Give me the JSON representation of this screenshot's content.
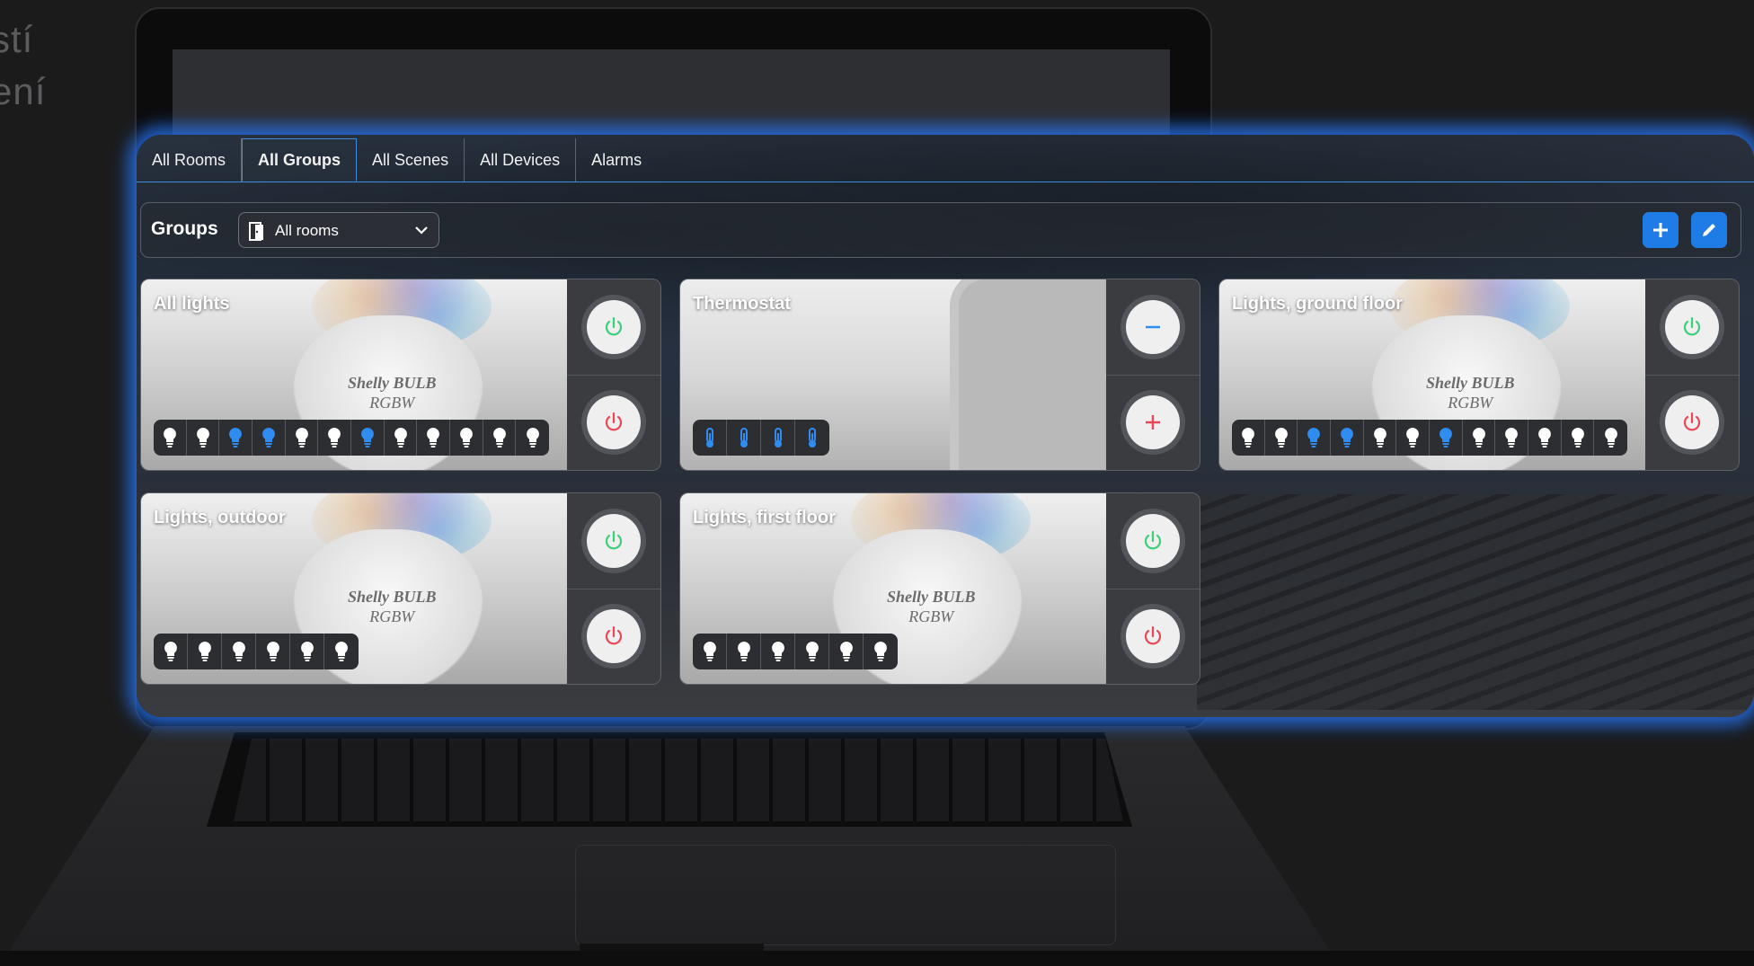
{
  "background": {
    "line1": "stí",
    "line2": "ení"
  },
  "tabs": [
    {
      "label": "All Rooms",
      "active": false
    },
    {
      "label": "All Groups",
      "active": true
    },
    {
      "label": "All Scenes",
      "active": false
    },
    {
      "label": "All Devices",
      "active": false
    },
    {
      "label": "Alarms",
      "active": false
    }
  ],
  "toolbar": {
    "title": "Groups",
    "room_select": {
      "selected": "All rooms",
      "icon": "door-icon"
    },
    "add_icon": "plus-icon",
    "edit_icon": "pencil-icon"
  },
  "colors": {
    "accent": "#1f7ce6",
    "device_on": "#2f8cf0",
    "device_off": "#ffffff",
    "power_on": "#3ccf7a",
    "power_off": "#e84855"
  },
  "groups": [
    {
      "name": "All lights",
      "kind": "lights",
      "brand": "Shelly",
      "brand_line1": "BULB",
      "brand_line2": "RGBW",
      "top_action": "power-on",
      "bottom_action": "power-off",
      "devices": [
        "off",
        "off",
        "on",
        "on",
        "off",
        "off",
        "on",
        "off",
        "off",
        "off",
        "off",
        "off"
      ]
    },
    {
      "name": "Thermostat",
      "kind": "thermostat",
      "top_action": "decrease",
      "bottom_action": "increase",
      "devices": [
        "on",
        "on",
        "on",
        "on"
      ]
    },
    {
      "name": "Lights, ground floor",
      "kind": "lights",
      "brand": "Shelly",
      "brand_line1": "BULB",
      "brand_line2": "RGBW",
      "top_action": "power-on",
      "bottom_action": "power-off",
      "devices": [
        "off",
        "off",
        "on",
        "on",
        "off",
        "off",
        "on",
        "off",
        "off",
        "off",
        "off",
        "off"
      ]
    },
    {
      "name": "Lights, outdoor",
      "kind": "lights",
      "brand": "Shelly",
      "brand_line1": "BULB",
      "brand_line2": "RGBW",
      "top_action": "power-on",
      "bottom_action": "power-off",
      "devices": [
        "off",
        "off",
        "off",
        "off",
        "off",
        "off"
      ]
    },
    {
      "name": "Lights, first floor",
      "kind": "lights",
      "brand": "Shelly",
      "brand_line1": "BULB",
      "brand_line2": "RGBW",
      "top_action": "power-on",
      "bottom_action": "power-off",
      "devices": [
        "off",
        "off",
        "off",
        "off",
        "off",
        "off"
      ]
    }
  ]
}
